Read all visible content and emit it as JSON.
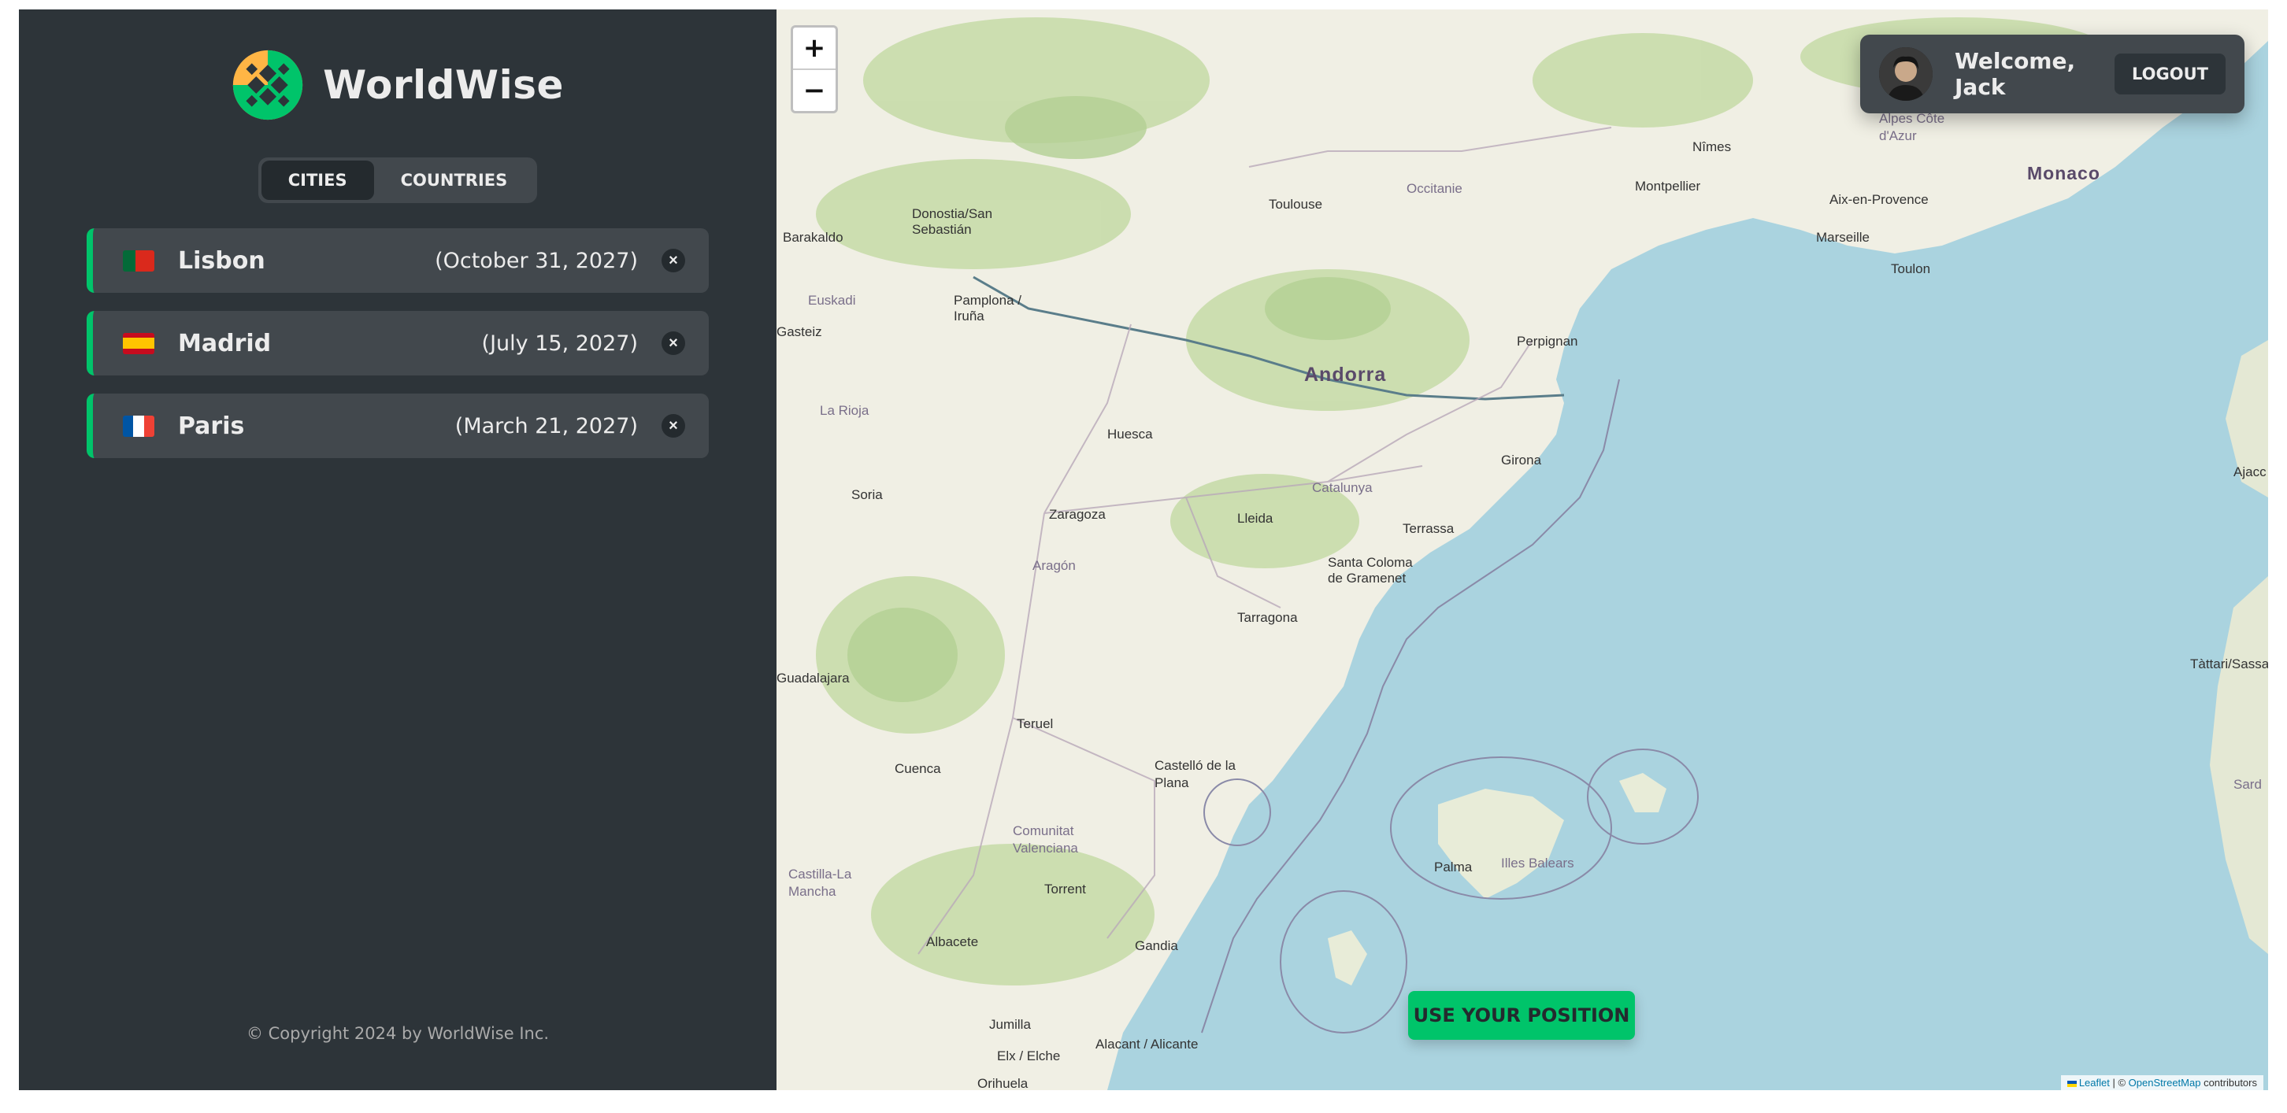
{
  "sidebar": {
    "logo_text": "WorldWise",
    "tabs": [
      {
        "label": "CITIES",
        "active": true
      },
      {
        "label": "COUNTRIES",
        "active": false
      }
    ],
    "cities": [
      {
        "name": "Lisbon",
        "date": "(October 31, 2027)",
        "flag": "portugal",
        "delete": "×"
      },
      {
        "name": "Madrid",
        "date": "(July 15, 2027)",
        "flag": "spain",
        "delete": "×"
      },
      {
        "name": "Paris",
        "date": "(March 21, 2027)",
        "flag": "france",
        "delete": "×"
      }
    ],
    "copyright": "© Copyright 2024 by WorldWise Inc."
  },
  "map": {
    "zoom_in": "+",
    "zoom_out": "−",
    "user": {
      "welcome": "Welcome, Jack",
      "logout": "LOGOUT"
    },
    "use_position": "USE YOUR POSITION",
    "attribution": {
      "leaflet": "Leaflet",
      "sep": " | © ",
      "osm": "OpenStreetMap",
      "suffix": " contributors"
    },
    "places": {
      "barakaldo": "Barakaldo",
      "donostia": "Donostia/San Sebastián",
      "euskadi": "Euskadi",
      "pamplona": "Pamplona / Iruña",
      "gasteiz": "Gasteiz",
      "toulouse": "Toulouse",
      "occitanie": "Occitanie",
      "nimes": "Nîmes",
      "montpellier": "Montpellier",
      "aix": "Aix-en-Provence",
      "marseille": "Marseille",
      "toulon": "Toulon",
      "alpes": "Alpes Côte d'Azur",
      "monaco": "Monaco",
      "perpignan": "Perpignan",
      "andorra": "Andorra",
      "larioja": "La Rioja",
      "huesca": "Huesca",
      "girona": "Girona",
      "soria": "Soria",
      "zaragoza": "Zaragoza",
      "lleida": "Lleida",
      "catalunya": "Catalunya",
      "terrassa": "Terrassa",
      "aragon": "Aragón",
      "santacoloma": "Santa Coloma de Gramenet",
      "tarragona": "Tarragona",
      "guadalajara": "Guadalajara",
      "teruel": "Teruel",
      "cuenca": "Cuenca",
      "castello": "Castelló de la Plana",
      "comunitat": "Comunitat Valenciana",
      "castilla": "Castilla-La Mancha",
      "torrent": "Torrent",
      "albacete": "Albacete",
      "gandia": "Gandia",
      "jumilla": "Jumilla",
      "elx": "Elx / Elche",
      "alacant": "Alacant / Alicante",
      "orihuela": "Orihuela",
      "palma": "Palma",
      "illes": "Illes Balears",
      "ajaccio": "Ajacc",
      "tattari": "Tàttari/Sassari",
      "sard": "Sard"
    }
  },
  "colors": {
    "sidebar_bg": "#2d3439",
    "item_bg": "#42484d",
    "accent_green": "#00c46a",
    "sea": "#aad3df",
    "land": "#f2efe9"
  }
}
